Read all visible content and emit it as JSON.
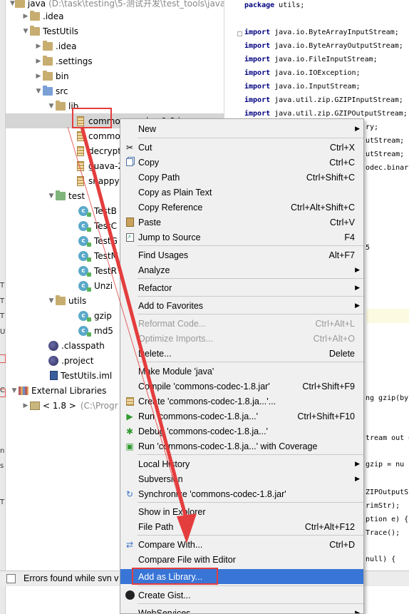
{
  "gutter": {
    "marks": [
      "T",
      "T",
      "T",
      "U",
      "C",
      "n",
      "s",
      "T"
    ]
  },
  "tree": {
    "items": [
      {
        "label": "java",
        "suffix": "(D:\\task\\testing\\5-测试开发\\test_tools\\java",
        "icon": "folder-icon",
        "arrow": "▼"
      },
      {
        "label": ".idea",
        "icon": "folder-icon",
        "arrow": "▶"
      },
      {
        "label": "TestUtils",
        "icon": "folder-icon",
        "arrow": "▼"
      },
      {
        "label": ".idea",
        "icon": "folder-icon",
        "arrow": "▶"
      },
      {
        "label": ".settings",
        "icon": "folder-icon",
        "arrow": "▶"
      },
      {
        "label": "bin",
        "icon": "folder-icon",
        "arrow": "▶"
      },
      {
        "label": "src",
        "icon": "source-folder-icon",
        "arrow": "▼"
      },
      {
        "label": "lib",
        "icon": "folder-icon",
        "arrow": "▼"
      },
      {
        "label": "commons-codec-1.8.jar",
        "icon": "jar-icon",
        "arrow": ""
      },
      {
        "label": "commo",
        "icon": "jar-icon",
        "arrow": ""
      },
      {
        "label": "decrypt",
        "icon": "jar-icon",
        "arrow": ""
      },
      {
        "label": "guava-2",
        "icon": "jar-icon",
        "arrow": ""
      },
      {
        "label": "snappy",
        "icon": "jar-icon",
        "arrow": ""
      },
      {
        "label": "test",
        "icon": "test-folder-icon",
        "arrow": "▼"
      },
      {
        "label": "TestB",
        "icon": "java-class-icon",
        "arrow": ""
      },
      {
        "label": "TestC",
        "icon": "java-class-icon",
        "arrow": ""
      },
      {
        "label": "TestG",
        "icon": "java-class-icon",
        "arrow": ""
      },
      {
        "label": "TestM",
        "icon": "java-class-icon",
        "arrow": ""
      },
      {
        "label": "TestR",
        "icon": "java-class-icon",
        "arrow": ""
      },
      {
        "label": "Unzi",
        "icon": "java-class-icon",
        "arrow": ""
      },
      {
        "label": "utils",
        "icon": "folder-icon",
        "arrow": "▼"
      },
      {
        "label": "gzip",
        "icon": "java-class-icon",
        "arrow": ""
      },
      {
        "label": "md5",
        "icon": "java-class-icon",
        "arrow": ""
      },
      {
        "label": ".classpath",
        "icon": "eclipse-icon",
        "arrow": ""
      },
      {
        "label": ".project",
        "icon": "eclipse-icon",
        "arrow": ""
      },
      {
        "label": "TestUtils.iml",
        "icon": "iml-icon",
        "arrow": ""
      },
      {
        "label": "External Libraries",
        "icon": "external-libraries-icon",
        "arrow": "▼"
      },
      {
        "label": "< 1.8 >",
        "suffix": "(C:\\Progr",
        "icon": "sdk-icon",
        "arrow": "▶"
      }
    ]
  },
  "editor": {
    "package_kw": "package",
    "package_name": " utils;",
    "import_kw": "import",
    "imports": [
      " java.io.ByteArrayInputStream;",
      " java.io.ByteArrayOutputStream;",
      " java.io.FileInputStream;",
      " java.io.IOException;",
      " java.io.InputStream;",
      " java.util.zip.GZIPInputStream;",
      " java.util.zip.GZIPOutputStream;"
    ],
    "fragments": {
      "f1": "ry;",
      "f2": "utStream;",
      "f3": "utStream;",
      "f4": "odec.binary",
      "f5": "5",
      "f6": "ng gzip(by",
      "f7": "tream out =",
      "f8": "gzip = nu",
      "f9": "ZIPOutputS",
      "f10": "rimStr);",
      "f11": "ption e) {",
      "f12": "Trace();",
      "f13": "null) {"
    }
  },
  "menu": {
    "items": [
      {
        "label": "New",
        "shortcut": "",
        "submenu": true,
        "icon": ""
      },
      {
        "label": "Cut",
        "shortcut": "Ctrl+X",
        "icon": "scissors-icon"
      },
      {
        "label": "Copy",
        "shortcut": "Ctrl+C",
        "icon": "copy-icon"
      },
      {
        "label": "Copy Path",
        "shortcut": "Ctrl+Shift+C",
        "icon": ""
      },
      {
        "label": "Copy as Plain Text",
        "shortcut": "",
        "icon": ""
      },
      {
        "label": "Copy Reference",
        "shortcut": "Ctrl+Alt+Shift+C",
        "icon": ""
      },
      {
        "label": "Paste",
        "shortcut": "Ctrl+V",
        "icon": "paste-icon"
      },
      {
        "label": "Jump to Source",
        "shortcut": "F4",
        "icon": "jump-source-icon"
      },
      {
        "label": "Find Usages",
        "shortcut": "Alt+F7",
        "icon": ""
      },
      {
        "label": "Analyze",
        "shortcut": "",
        "submenu": true,
        "icon": ""
      },
      {
        "label": "Refactor",
        "shortcut": "",
        "submenu": true,
        "icon": ""
      },
      {
        "label": "Add to Favorites",
        "shortcut": "",
        "submenu": true,
        "icon": ""
      },
      {
        "label": "Reformat Code...",
        "shortcut": "Ctrl+Alt+L",
        "disabled": true,
        "icon": ""
      },
      {
        "label": "Optimize Imports...",
        "shortcut": "Ctrl+Alt+O",
        "disabled": true,
        "icon": ""
      },
      {
        "label": "Delete...",
        "shortcut": "Delete",
        "icon": ""
      },
      {
        "label": "Make Module 'java'",
        "shortcut": "",
        "icon": ""
      },
      {
        "label": "Compile 'commons-codec-1.8.jar'",
        "shortcut": "Ctrl+Shift+F9",
        "icon": ""
      },
      {
        "label": "Create 'commons-codec-1.8.ja...'...",
        "shortcut": "",
        "icon": "run-config-icon"
      },
      {
        "label": "Run 'commons-codec-1.8.ja...'",
        "shortcut": "Ctrl+Shift+F10",
        "icon": "run-icon"
      },
      {
        "label": "Debug 'commons-codec-1.8.ja...'",
        "shortcut": "",
        "icon": "debug-icon"
      },
      {
        "label": "Run 'commons-codec-1.8.ja...' with Coverage",
        "shortcut": "",
        "icon": "coverage-icon"
      },
      {
        "label": "Local History",
        "shortcut": "",
        "submenu": true,
        "icon": ""
      },
      {
        "label": "Subversion",
        "shortcut": "",
        "submenu": true,
        "icon": ""
      },
      {
        "label": "Synchronize 'commons-codec-1.8.jar'",
        "shortcut": "",
        "icon": "sync-icon"
      },
      {
        "label": "Show in Explorer",
        "shortcut": "",
        "icon": ""
      },
      {
        "label": "File Path",
        "shortcut": "Ctrl+Alt+F12",
        "icon": ""
      },
      {
        "label": "Compare With...",
        "shortcut": "Ctrl+D",
        "icon": "compare-icon"
      },
      {
        "label": "Compare File with Editor",
        "shortcut": "",
        "icon": ""
      },
      {
        "label": "Add as Library...",
        "shortcut": "",
        "highlighted": true,
        "icon": ""
      },
      {
        "label": "Create Gist...",
        "shortcut": "",
        "icon": "github-icon"
      },
      {
        "label": "WebServices",
        "shortcut": "",
        "submenu": true,
        "icon": ""
      }
    ]
  },
  "status": {
    "text": "Errors found while svn v"
  },
  "colors": {
    "highlight": "#3875d7",
    "annotation": "#e43d3d",
    "selection": "#d5d5d5"
  }
}
